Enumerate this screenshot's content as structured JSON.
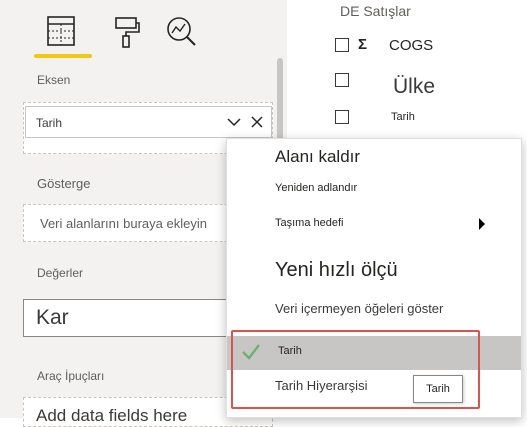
{
  "viz_pane": {
    "tabs": [
      {
        "icon": "fields-table-icon",
        "active": true
      },
      {
        "icon": "format-paint-roller-icon",
        "active": false
      },
      {
        "icon": "analytics-magnifier-icon",
        "active": false
      }
    ],
    "accent_color": "#f2c811",
    "sections": {
      "axis_label": "Eksen",
      "axis_field": "Tarih",
      "legend_label": "Gösterge",
      "legend_placeholder": "Veri alanlarını buraya ekleyin",
      "values_label": "Değerler",
      "values_field": "Kar",
      "tooltips_label": "Araç İpuçları",
      "tooltips_placeholder": "Add data fields here"
    }
  },
  "fields_pane": {
    "table_name": "DE Satışlar",
    "fields": [
      {
        "name": "COGS",
        "has_sigma": true
      },
      {
        "name": "Ülke",
        "has_sigma": false
      },
      {
        "name": "Tarih",
        "has_sigma": false
      }
    ]
  },
  "context_menu": {
    "remove_field": "Alanı kaldır",
    "rename": "Yeniden adlandır",
    "move_to": "Taşıma hedefi",
    "new_quick_measure": "Yeni hızlı ölçü",
    "show_items_no_data": "Veri içermeyen öğeleri göster",
    "date_option": "Tarih",
    "date_hierarchy_option": "Tarih Hiyerarşisi",
    "tooltip": "Tarih",
    "highlight_color": "#d9534f",
    "check_color": "#6bb36b"
  }
}
